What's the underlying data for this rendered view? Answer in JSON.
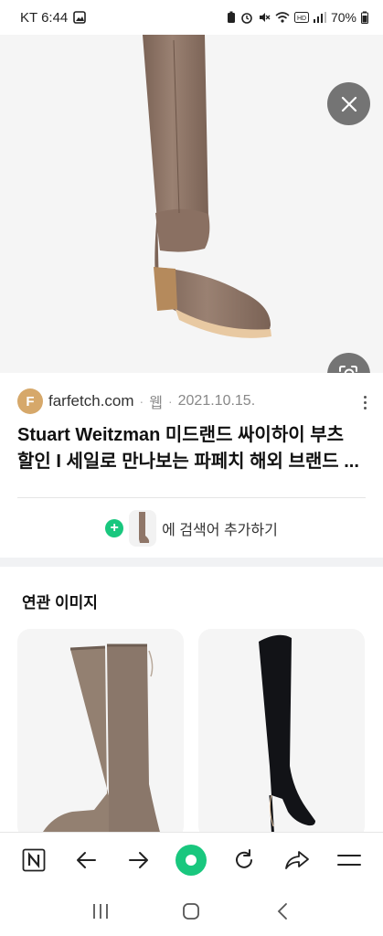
{
  "status_bar": {
    "carrier_time": "KT 6:44",
    "battery": "70%"
  },
  "hero": {
    "close_label": "닫기",
    "lens_label": "이미지 검색"
  },
  "source": {
    "avatar_letter": "F",
    "domain": "farfetch.com",
    "type": "웹",
    "date": "2021.10.15."
  },
  "result": {
    "title_line1": "Stuart Weitzman 미드랜드 싸이하이 부츠",
    "title_line2": "할인 I 세일로 만나보는 파페치 해외 브랜드 ..."
  },
  "add_search": {
    "plus": "+",
    "label": "에 검색어 추가하기"
  },
  "related": {
    "title": "연관 이미지"
  },
  "colors": {
    "accent_green": "#19c77e",
    "overlay_button": "#505050",
    "boot_taupe": "#8f7668",
    "boot_black": "#121317"
  },
  "icons": {
    "toolbar": [
      "naver-n-icon",
      "back-arrow-icon",
      "forward-arrow-icon",
      "home-green-icon",
      "refresh-icon",
      "share-icon",
      "menu-icon"
    ],
    "navbar": [
      "recent-apps-icon",
      "home-icon",
      "back-icon"
    ]
  }
}
